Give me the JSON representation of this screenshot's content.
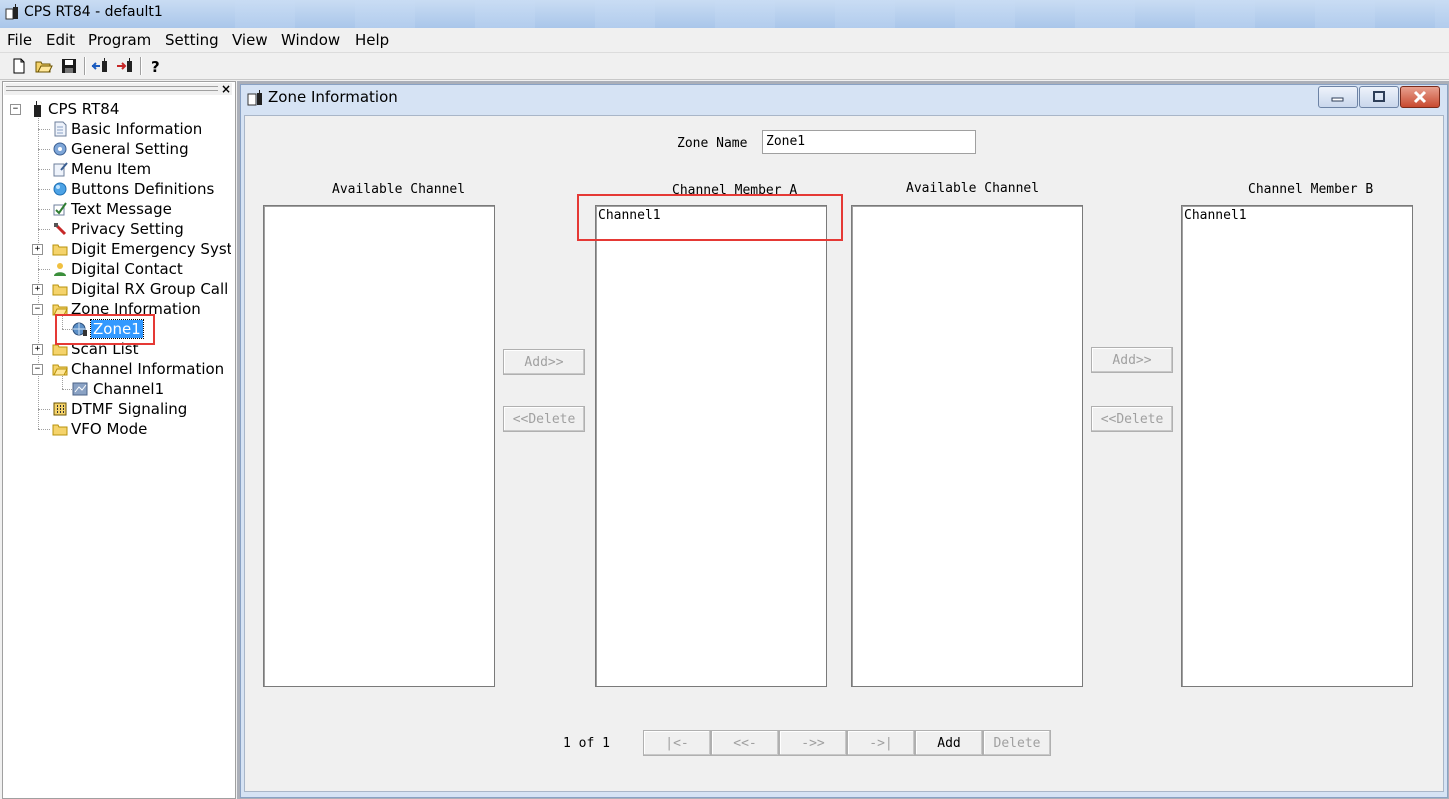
{
  "window": {
    "title": "CPS RT84 - default1"
  },
  "menu": [
    "File",
    "Edit",
    "Program",
    "Setting",
    "View",
    "Window",
    "Help"
  ],
  "toolbar": {
    "icons": [
      "new-file-icon",
      "open-folder-icon",
      "save-icon",
      "read-from-radio-icon",
      "write-to-radio-icon",
      "help-icon"
    ]
  },
  "tree": {
    "close_label": "×",
    "root": "CPS RT84",
    "items": [
      "Basic Information",
      "General Setting",
      "Menu Item",
      "Buttons Definitions",
      "Text Message",
      "Privacy Setting",
      "Digit Emergency Syste",
      "Digital Contact",
      "Digital RX Group Call",
      "Zone Information",
      "Zone1",
      "Scan List",
      "Channel Information",
      "Channel1",
      "DTMF Signaling",
      "VFO Mode"
    ],
    "selected": "Zone1"
  },
  "child": {
    "title": "Zone Information",
    "zone_name_label": "Zone Name",
    "zone_name_value": "Zone1",
    "available_a_label": "Available Channel",
    "member_a_label": "Channel Member A",
    "available_b_label": "Available Channel",
    "member_b_label": "Channel Member B",
    "member_a_items": [
      "Channel1"
    ],
    "member_b_items": [
      "Channel1"
    ],
    "add_label": "Add>>",
    "delete_label": "<<Delete",
    "page_info": "1 of 1",
    "nav": {
      "first": "|<-",
      "prev": "<<-",
      "next": "->>",
      "last": "->|",
      "add": "Add",
      "delete": "Delete"
    }
  },
  "colors": {
    "highlight": "#e53935",
    "selection": "#3399ff",
    "title_gradient": "#a9c6ea"
  }
}
